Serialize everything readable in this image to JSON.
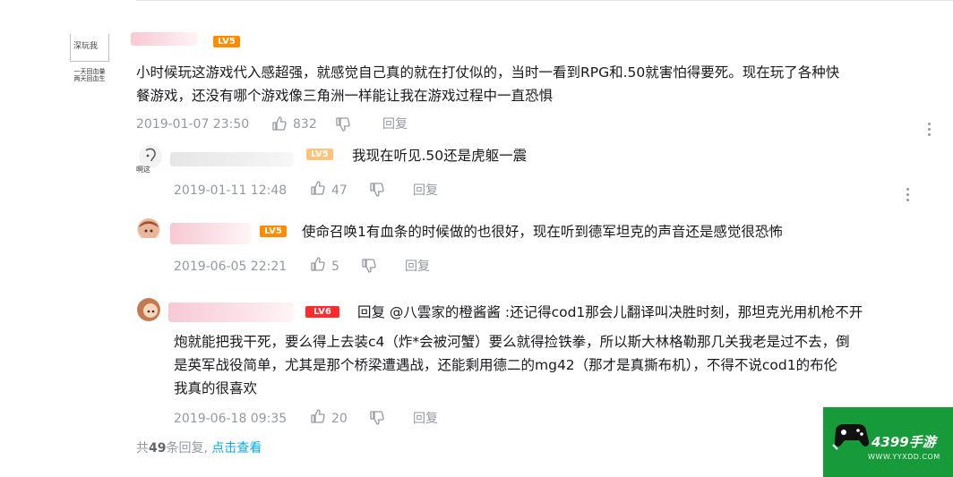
{
  "main_comment": {
    "avatar_box_text": "深玩我",
    "avatar_caption_1": "一天回血量",
    "avatar_caption_2": "两天回血生",
    "level": "LV5",
    "text_line_1": "小时候玩这游戏代入感超强，就感觉自己真的就在打仗似的，当时一看到RPG和.50就害怕得要死。现在玩了各种快",
    "text_line_2": "餐游戏，还没有哪个游戏像三角洲一样能让我在游戏过程中一直恐惧",
    "time": "2019-01-07 23:50",
    "likes": "832",
    "reply_label": "回复"
  },
  "replies": [
    {
      "avatar_caption": "啊这",
      "level": "LV5",
      "text": "我现在听见.50还是虎躯一震",
      "time": "2019-01-11 12:48",
      "likes": "47",
      "reply_label": "回复"
    },
    {
      "level": "LV5",
      "text": "使命召唤1有血条的时候做的也很好，现在听到德军坦克的声音还是感觉很恐怖",
      "time": "2019-06-05 22:21",
      "likes": "5",
      "reply_label": "回复"
    },
    {
      "level": "LV6",
      "text_line_1": "回复 @八雲家的橙酱酱 :还记得cod1那会儿翻译叫决胜时刻，那坦克光用机枪不开",
      "text_line_2": "炮就能把我干死，要么得上去装c4（炸*会被河蟹）要么就得捡铁拳，所以斯大林格勒那几关我老是过不去，倒",
      "text_line_3": "是英军战役简单，尤其是那个桥梁遭遇战，还能剩用德二的mg42（那才是真撕布机），不得不说cod1的布伦",
      "text_line_4": "我真的很喜欢",
      "time": "2019-06-18 09:35",
      "likes": "20",
      "reply_label": "回复"
    }
  ],
  "footer": {
    "prefix": "共",
    "count": "49",
    "suffix": "条回复,",
    "view_link": "点击查看"
  },
  "watermark": {
    "brand": "4399手游",
    "url": "WWW.YYXDD.COM"
  },
  "colors": {
    "meta_gray": "#9499a0",
    "link_blue": "#00aeec",
    "level5_orange": "#ff8c00",
    "level6_red": "#ff2a2a",
    "logo_green": "#179a3a"
  },
  "icons": [
    "like-icon",
    "dislike-icon",
    "more-icon"
  ]
}
